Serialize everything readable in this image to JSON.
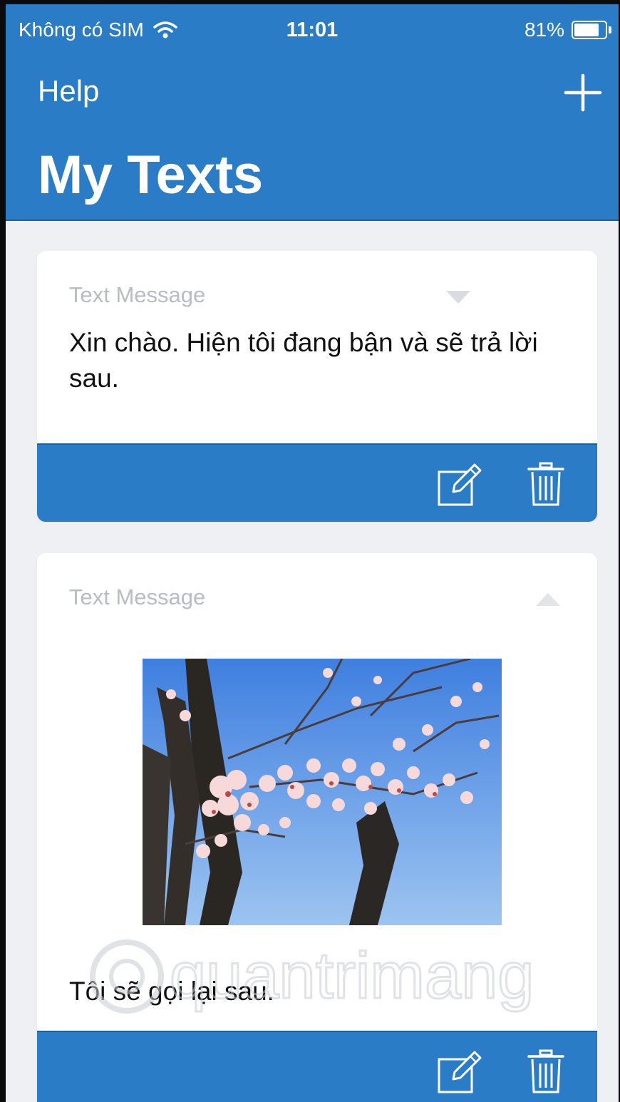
{
  "status_bar": {
    "carrier": "Không có SIM",
    "time": "11:01",
    "battery": "81%",
    "battery_level": 0.81,
    "wifi_icon": "wifi-icon",
    "battery_icon": "battery-icon"
  },
  "nav": {
    "help_label": "Help",
    "add_icon": "plus-icon",
    "title": "My Texts"
  },
  "cards": [
    {
      "type_label": "Text Message",
      "expanded": false,
      "chevron_icon": "chevron-down-icon",
      "message": "Xin chào. Hiện tôi đang bận và sẽ trả lời sau.",
      "edit_icon": "edit-icon",
      "delete_icon": "trash-icon"
    },
    {
      "type_label": "Text Message",
      "expanded": true,
      "chevron_icon": "chevron-up-icon",
      "has_photo": true,
      "message": "Tôi sẽ gọi lại sau.",
      "edit_icon": "edit-icon",
      "delete_icon": "trash-icon"
    }
  ],
  "colors": {
    "primary": "#2a7cc7",
    "background": "#eef0f4",
    "card": "#ffffff",
    "muted_text": "#b8bcc3"
  },
  "watermark": "quantrimang"
}
